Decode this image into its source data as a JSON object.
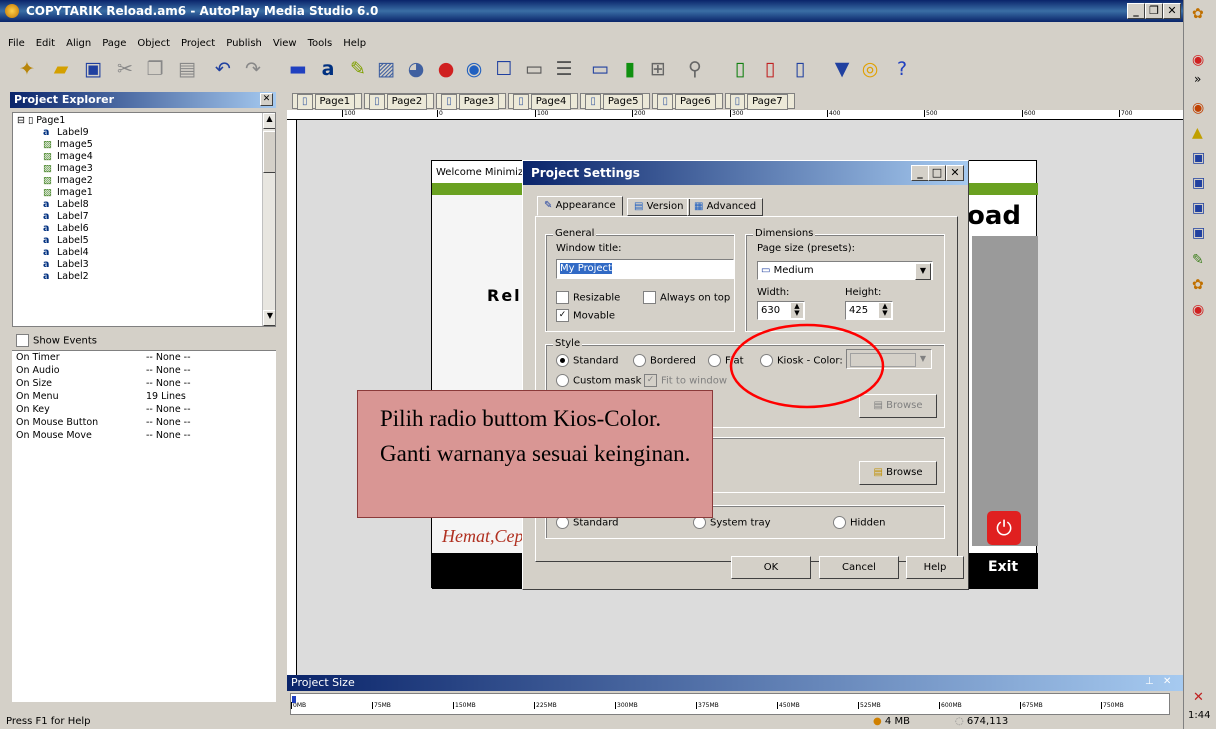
{
  "window": {
    "title": "COPYTARIK Reload.am6 - AutoPlay Media Studio 6.0"
  },
  "menu": [
    "File",
    "Edit",
    "Align",
    "Page",
    "Object",
    "Project",
    "Publish",
    "View",
    "Tools",
    "Help"
  ],
  "toolbar_icons": [
    "wand-icon",
    "open-folder-icon",
    "save-icon",
    "cut-icon",
    "copy-icon",
    "paste-icon",
    "undo-icon",
    "redo-icon",
    "button-object-icon",
    "label-object-icon",
    "paragraph-icon",
    "image-icon",
    "flash-icon",
    "video-icon",
    "web-icon",
    "input-icon",
    "listbox-icon",
    "combobox-icon",
    "progress-icon",
    "tree-icon",
    "slideshow-icon",
    "zoom-icon",
    "new-page-icon",
    "delete-page-icon",
    "preview-icon",
    "publish-icon",
    "build-icon",
    "help-icon"
  ],
  "explorer": {
    "title": "Project Explorer",
    "root": "Page1",
    "items": [
      "Label9",
      "Image5",
      "Image4",
      "Image3",
      "Image2",
      "Image1",
      "Label8",
      "Label7",
      "Label6",
      "Label5",
      "Label4",
      "Label3",
      "Label2"
    ],
    "show_events": "Show Events",
    "events": [
      {
        "name": "On Timer",
        "value": "-- None --"
      },
      {
        "name": "On Audio",
        "value": "-- None --"
      },
      {
        "name": "On Size",
        "value": "-- None --"
      },
      {
        "name": "On Menu",
        "value": "19 Lines"
      },
      {
        "name": "On Key",
        "value": "-- None --"
      },
      {
        "name": "On Mouse Button",
        "value": "-- None --"
      },
      {
        "name": "On Mouse Move",
        "value": "-- None --"
      }
    ]
  },
  "tabs": [
    "Page1",
    "Page2",
    "Page3",
    "Page4",
    "Page5",
    "Page6",
    "Page7"
  ],
  "ruler_labels": [
    "100",
    "0",
    "100",
    "200",
    "300",
    "400",
    "500",
    "600",
    "700"
  ],
  "app_preview": {
    "menu": "Welcome  Minimiz",
    "title_fragment": "oad",
    "brand": "Rel",
    "exit": "Exit",
    "tagline": "Hemat,Cep"
  },
  "dialog": {
    "title": "Project Settings",
    "tabs": [
      "Appearance",
      "Version",
      "Advanced"
    ],
    "general": {
      "legend": "General",
      "window_title_label": "Window title:",
      "window_title_value": "My Project",
      "resizable": "Resizable",
      "always_on_top": "Always on top",
      "movable": "Movable"
    },
    "dimensions": {
      "legend": "Dimensions",
      "preset_label": "Page size (presets):",
      "preset_value": "Medium",
      "width_label": "Width:",
      "width_value": "630",
      "height_label": "Height:",
      "height_value": "425"
    },
    "style": {
      "legend": "Style",
      "standard": "Standard",
      "bordered": "Bordered",
      "flat": "Flat",
      "kiosk": "Kiosk - Color:",
      "custom_mask": "Custom mask",
      "fit_to_window": "Fit to window"
    },
    "browse": "Browse",
    "hidden": "Hidden",
    "system_tray": "System tray",
    "standard2": "Standard",
    "ok": "OK",
    "cancel": "Cancel",
    "help": "Help"
  },
  "callout": {
    "text": "Pilih radio buttom Kios-Color. Ganti warnanya sesuai keinginan."
  },
  "project_size": {
    "title": "Project Size",
    "marks": [
      "0MB",
      "75MB",
      "150MB",
      "225MB",
      "300MB",
      "375MB",
      "450MB",
      "525MB",
      "600MB",
      "675MB",
      "750MB"
    ]
  },
  "status": {
    "help": "Press F1 for Help",
    "size": "4 MB",
    "count": "674,113",
    "clock": "1:44"
  },
  "colors": {
    "title": "#0a246a",
    "callout": "#d99694",
    "accent": "#ff0000"
  }
}
